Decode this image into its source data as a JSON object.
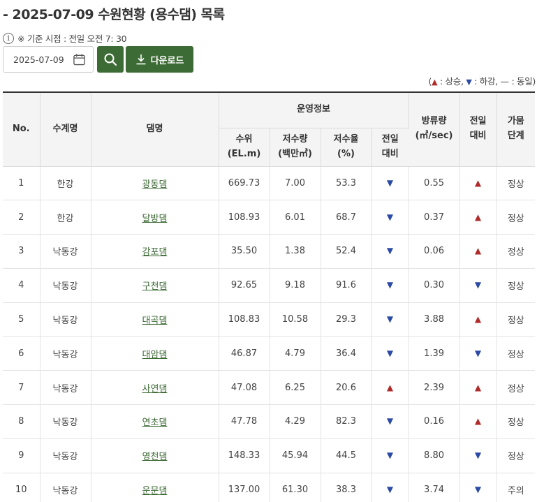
{
  "page": {
    "title": "- 2025-07-09 수원현황 (용수댐) 목록"
  },
  "basis": {
    "icon": "info-icon",
    "text": "※ 기준 시점 : 전일 오전 7: 30"
  },
  "search": {
    "date_value": "2025-07-09",
    "download_label": "다운로드"
  },
  "legend": {
    "open": "(",
    "up_label": ": 상승,",
    "down_label": ": 하강,",
    "same_symbol": "—",
    "same_label": ": 동일)"
  },
  "table": {
    "headers": {
      "no": "No.",
      "basin": "수계명",
      "dam": "댐명",
      "operation": "운영정보",
      "level_1": "수위",
      "level_2": "(EL.m)",
      "storage_1": "저수량",
      "storage_2": "(백만㎥)",
      "rate_1": "저수율",
      "rate_2": "(%)",
      "prev_1": "전일",
      "prev_2": "대비",
      "discharge_1": "방류량",
      "discharge_2": "(㎥/sec)",
      "prev2_1": "전일",
      "prev2_2": "대비",
      "drought_1": "가뭄",
      "drought_2": "단계"
    },
    "rows": [
      {
        "no": "1",
        "basin": "한강",
        "dam": "광동댐",
        "level": "669.73",
        "storage": "7.00",
        "rate": "53.3",
        "rate_trend": "down",
        "discharge": "0.55",
        "discharge_trend": "up",
        "drought": "정상"
      },
      {
        "no": "2",
        "basin": "한강",
        "dam": "달방댐",
        "level": "108.93",
        "storage": "6.01",
        "rate": "68.7",
        "rate_trend": "down",
        "discharge": "0.37",
        "discharge_trend": "up",
        "drought": "정상"
      },
      {
        "no": "3",
        "basin": "낙동강",
        "dam": "감포댐",
        "level": "35.50",
        "storage": "1.38",
        "rate": "52.4",
        "rate_trend": "down",
        "discharge": "0.06",
        "discharge_trend": "up",
        "drought": "정상"
      },
      {
        "no": "4",
        "basin": "낙동강",
        "dam": "구천댐",
        "level": "92.65",
        "storage": "9.18",
        "rate": "91.6",
        "rate_trend": "down",
        "discharge": "0.30",
        "discharge_trend": "down",
        "drought": "정상"
      },
      {
        "no": "5",
        "basin": "낙동강",
        "dam": "대곡댐",
        "level": "108.83",
        "storage": "10.58",
        "rate": "29.3",
        "rate_trend": "down",
        "discharge": "3.88",
        "discharge_trend": "up",
        "drought": "정상"
      },
      {
        "no": "6",
        "basin": "낙동강",
        "dam": "대암댐",
        "level": "46.87",
        "storage": "4.79",
        "rate": "36.4",
        "rate_trend": "down",
        "discharge": "1.39",
        "discharge_trend": "down",
        "drought": "정상"
      },
      {
        "no": "7",
        "basin": "낙동강",
        "dam": "사연댐",
        "level": "47.08",
        "storage": "6.25",
        "rate": "20.6",
        "rate_trend": "up",
        "discharge": "2.39",
        "discharge_trend": "up",
        "drought": "정상"
      },
      {
        "no": "8",
        "basin": "낙동강",
        "dam": "연초댐",
        "level": "47.78",
        "storage": "4.29",
        "rate": "82.3",
        "rate_trend": "down",
        "discharge": "0.16",
        "discharge_trend": "up",
        "drought": "정상"
      },
      {
        "no": "9",
        "basin": "낙동강",
        "dam": "영천댐",
        "level": "148.33",
        "storage": "45.94",
        "rate": "44.5",
        "rate_trend": "down",
        "discharge": "8.80",
        "discharge_trend": "down",
        "drought": "정상"
      },
      {
        "no": "10",
        "basin": "낙동강",
        "dam": "운문댐",
        "level": "137.00",
        "storage": "61.30",
        "rate": "38.3",
        "rate_trend": "down",
        "discharge": "3.74",
        "discharge_trend": "down",
        "drought": "주의"
      }
    ]
  },
  "colors": {
    "brand_green": "#3d6b35",
    "up_red": "#b02a2a",
    "down_blue": "#2b4aa6"
  }
}
